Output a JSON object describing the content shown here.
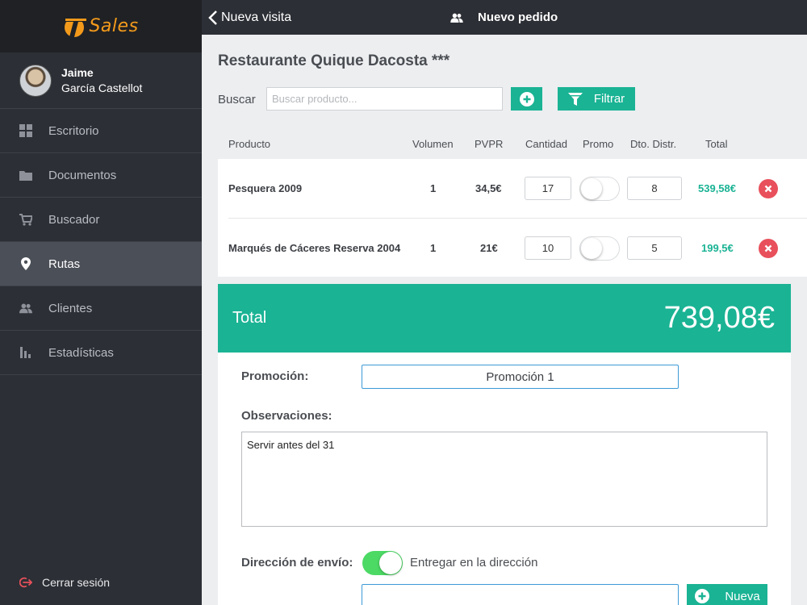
{
  "app": {
    "logo_text": "Sales",
    "brand_color": "#f39a1b",
    "accent_color": "#1ab394"
  },
  "user": {
    "first_name": "Jaime",
    "last_name": "García Castellot"
  },
  "sidebar": {
    "items": [
      {
        "label": "Escritorio",
        "icon": "grid-icon",
        "active": false
      },
      {
        "label": "Documentos",
        "icon": "folder-icon",
        "active": false
      },
      {
        "label": "Buscador",
        "icon": "cart-icon",
        "active": false
      },
      {
        "label": "Rutas",
        "icon": "location-pin-icon",
        "active": true
      },
      {
        "label": "Clientes",
        "icon": "users-icon",
        "active": false
      },
      {
        "label": "Estadísticas",
        "icon": "bar-chart-icon",
        "active": false
      }
    ],
    "logout_label": "Cerrar sesión"
  },
  "topbar": {
    "back_label": "Nueva visita",
    "title": "Nuevo pedido"
  },
  "main": {
    "client_title": "Restaurante Quique Dacosta ***",
    "search": {
      "label": "Buscar",
      "placeholder": "Buscar producto..."
    },
    "filter_label": "Filtrar",
    "columns": [
      "Producto",
      "Volumen",
      "PVPR",
      "Cantidad",
      "Promo",
      "Dto. Distr.",
      "Total"
    ],
    "rows": [
      {
        "product": "Pesquera 2009",
        "volume": "1",
        "pvpr": "34,5€",
        "quantity": "17",
        "promo": false,
        "discount": "8",
        "total": "539,58€"
      },
      {
        "product": "Marqués de Cáceres Reserva 2004",
        "volume": "1",
        "pvpr": "21€",
        "quantity": "10",
        "promo": false,
        "discount": "5",
        "total": "199,5€"
      }
    ],
    "total": {
      "label": "Total",
      "value": "739,08€"
    },
    "form": {
      "promo_label": "Promoción:",
      "promo_value": "Promoción 1",
      "obs_label": "Observaciones:",
      "obs_value": "Servir antes del 31",
      "ship_label": "Dirección de envío:",
      "ship_toggle_on": true,
      "ship_text": "Entregar en la dirección",
      "new_label": "Nueva"
    }
  }
}
